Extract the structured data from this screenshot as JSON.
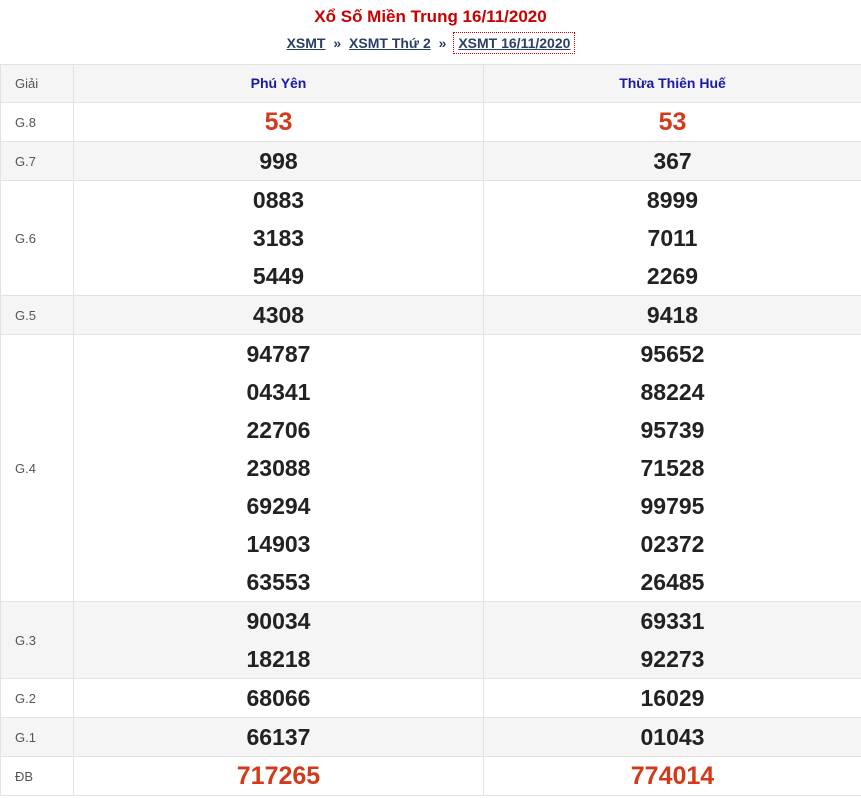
{
  "title": "Xổ Số Miền Trung 16/11/2020",
  "breadcrumb": {
    "home": "XSMT",
    "sep1": "»",
    "day": "XSMT Thứ 2",
    "sep2": "»",
    "current": "XSMT 16/11/2020"
  },
  "columns": {
    "label": "Giải",
    "p1": "Phú Yên",
    "p2": "Thừa Thiên Huế"
  },
  "rows": [
    {
      "label": "G.8",
      "p1": [
        "53"
      ],
      "p2": [
        "53"
      ]
    },
    {
      "label": "G.7",
      "p1": [
        "998"
      ],
      "p2": [
        "367"
      ]
    },
    {
      "label": "G.6",
      "p1": [
        "0883",
        "3183",
        "5449"
      ],
      "p2": [
        "8999",
        "7011",
        "2269"
      ]
    },
    {
      "label": "G.5",
      "p1": [
        "4308"
      ],
      "p2": [
        "9418"
      ]
    },
    {
      "label": "G.4",
      "p1": [
        "94787",
        "04341",
        "22706",
        "23088",
        "69294",
        "14903",
        "63553"
      ],
      "p2": [
        "95652",
        "88224",
        "95739",
        "71528",
        "99795",
        "02372",
        "26485"
      ]
    },
    {
      "label": "G.3",
      "p1": [
        "90034",
        "18218"
      ],
      "p2": [
        "69331",
        "92273"
      ]
    },
    {
      "label": "G.2",
      "p1": [
        "68066"
      ],
      "p2": [
        "16029"
      ]
    },
    {
      "label": "G.1",
      "p1": [
        "66137"
      ],
      "p2": [
        "01043"
      ]
    },
    {
      "label": "ĐB",
      "p1": [
        "717265"
      ],
      "p2": [
        "774014"
      ]
    }
  ],
  "colors": {
    "title": "#c80000",
    "highlight": "#d33a1a",
    "province": "#1a1aa6",
    "alt_row": "#f5f5f5",
    "border": "#e2e2e2"
  }
}
